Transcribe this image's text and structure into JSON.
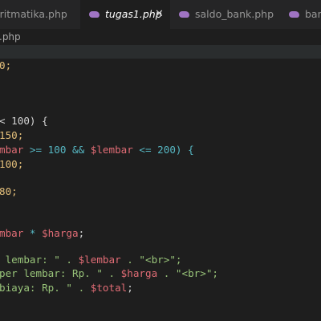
{
  "tabs": [
    {
      "label": "aritmatika.php",
      "active": false
    },
    {
      "label": "tugas1.php",
      "active": true
    },
    {
      "label": "saldo_bank.php",
      "active": false
    },
    {
      "label": "bang",
      "active": false
    }
  ],
  "breadcrumb": ".php",
  "code": {
    "l1": "0;",
    "l2": "< 100) {",
    "l3": "150;",
    "l4a": "mbar",
    "l4b": " >= 100 && ",
    "l4c": "$lembar",
    "l4d": " <= 200) {",
    "l5": "100;",
    "l6": "80;",
    "l7a": "mbar",
    "l7b": " * ",
    "l7c": "$harga",
    "l7d": ";",
    "l8a": " lembar: \" . ",
    "l8b": "$lembar",
    "l8c": " . \"<br>\";",
    "l9a": "per lembar: Rp. \" . ",
    "l9b": "$harga",
    "l9c": " . \"<br>\";",
    "l10a": "biaya: Rp. \" . ",
    "l10b": "$total",
    "l10c": ";"
  }
}
